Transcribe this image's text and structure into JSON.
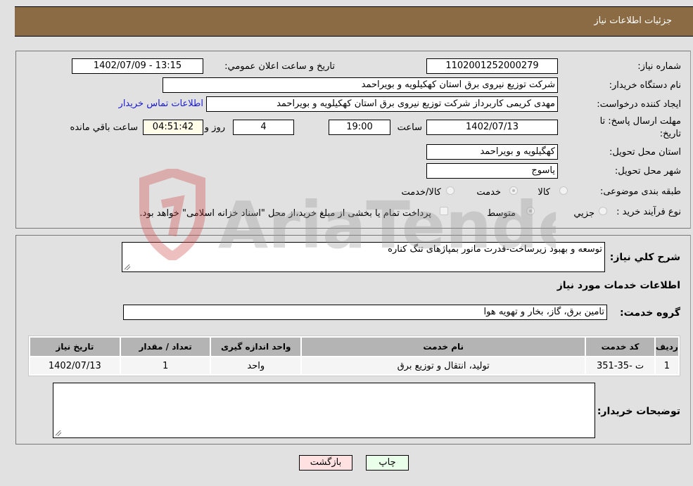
{
  "header": {
    "title": "جزئيات اطلاعات نیاز"
  },
  "details": {
    "need_number_label": "شماره نیاز:",
    "need_number": "1102001252000279",
    "announce_label": "تاریخ و ساعت اعلان عمومي:",
    "announce_value": "1402/07/09 - 13:15",
    "buyer_org_label": "نام دستگاه خریدار:",
    "buyer_org": "شرکت توزیع نیروی برق استان کهکیلویه و بویراحمد",
    "creator_label": "ایجاد کننده درخواست:",
    "creator": "مهدی کریمی کاربرداز شرکت توزیع نیروی برق استان کهکیلویه و بویراحمد",
    "contact_link": "اطلاعات تماس خریدار",
    "deadline_label_line1": "مهلت ارسال پاسخ: تا",
    "deadline_label_line2": "تاریخ:",
    "deadline_date": "1402/07/13",
    "time_label": "ساعت",
    "deadline_time": "19:00",
    "days_value": "4",
    "days_label": "روز و",
    "remaining_time": "04:51:42",
    "remaining_label": "ساعت باقي مانده",
    "province_label": "استان محل تحویل:",
    "province": "کهگیلویه و بویراحمد",
    "city_label": "شهر محل تحویل:",
    "city": "یاسوج",
    "category_label": "طبقه بندی موضوعی:",
    "category_options": [
      {
        "label": "کالا",
        "checked": false
      },
      {
        "label": "خدمت",
        "checked": true
      },
      {
        "label": "کالا/خدمت",
        "checked": false
      }
    ],
    "process_label": "نوع فرآیند خرید :",
    "process_options": [
      {
        "label": "جزيي",
        "checked": false
      },
      {
        "label": "متوسط",
        "checked": true
      }
    ],
    "payment_note": "پرداخت تمام یا بخشی از مبلغ خرید،از محل \"اسناد خزانه اسلامی\" خواهد بود."
  },
  "services": {
    "description_label": "شرح کلي نیاز:",
    "description": "توسعه و بهبود زیرساخت-قدرت مانور بمپاژهای تنگ کناره",
    "section_title": "اطلاعات خدمات مورد نیاز",
    "group_label": "گروه خدمت:",
    "group_value": "تامین برق، گاز، بخار و تهویه هوا",
    "table": {
      "headers": [
        "ردیف",
        "کد خدمت",
        "نام خدمت",
        "واحد اندازه گیری",
        "تعداد / مقدار",
        "تاریخ نیاز"
      ],
      "rows": [
        [
          "1",
          "ت -35-351",
          "تولید، انتقال و توزیع برق",
          "واحد",
          "1",
          "1402/07/13"
        ]
      ]
    },
    "buyer_notes_label": "توضیحات خریدار:",
    "buyer_notes": ""
  },
  "buttons": {
    "print": "چاپ",
    "back": "بازگشت"
  },
  "watermark": {
    "text": "AriaTender.neT"
  }
}
